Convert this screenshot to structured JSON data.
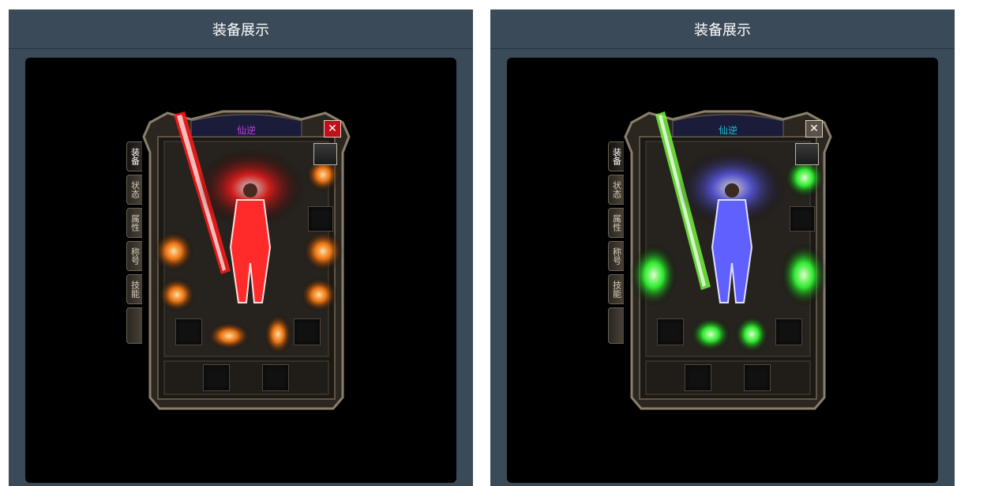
{
  "panels": [
    {
      "header": "装备展示",
      "window_title": "仙逆",
      "title_color": "#c040e0",
      "close_symbol": "✕",
      "close_bg": "#c0101a",
      "tabs": [
        "装备",
        "状态",
        "属性",
        "称号",
        "技能"
      ],
      "glow_primary": "#ff1a1a",
      "glow_secondary": "#ff7a10",
      "figure_color": "#ff2a2a"
    },
    {
      "header": "装备展示",
      "window_title": "仙逆",
      "title_color": "#20c0d0",
      "close_symbol": "✕",
      "close_bg": "#5a5248",
      "tabs": [
        "装备",
        "状态",
        "属性",
        "称号",
        "技能"
      ],
      "glow_primary": "#30ff30",
      "glow_secondary": "#7aff40",
      "figure_color": "#6060ff"
    }
  ]
}
